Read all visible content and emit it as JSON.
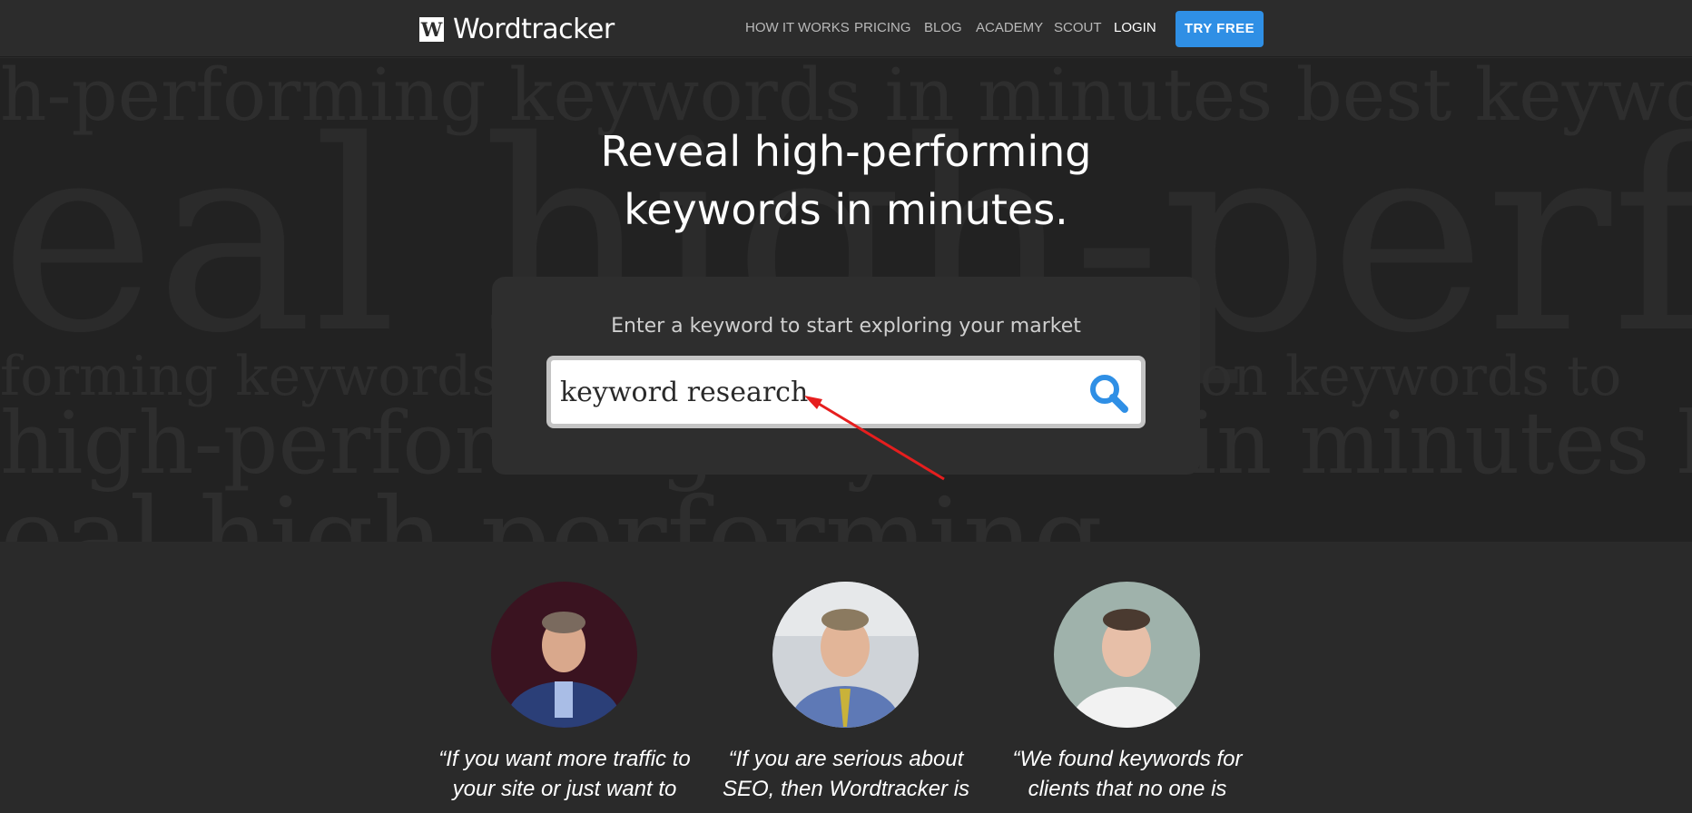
{
  "brand": {
    "mark": "W",
    "name": "Wordtracker"
  },
  "nav": {
    "items": [
      "HOW IT WORKS",
      "PRICING",
      "BLOG",
      "ACADEMY",
      "SCOUT",
      "LOGIN"
    ],
    "cta": "TRY FREE"
  },
  "hero": {
    "background_lines": [
      "h-performing keywords in minutes best keywords",
      "eal high-perform",
      "forming keywords in minutes low competition keywords to",
      "high-performing keywords in minutes be",
      "eal high-performing"
    ],
    "title_line1": "Reveal high-performing",
    "title_line2": "keywords in minutes.",
    "search_prompt": "Enter a keyword to start exploring your market",
    "search_value": "keyword research"
  },
  "testimonials": [
    {
      "quote_line1": "“If you want more traffic to",
      "quote_line2": "your site or just want to"
    },
    {
      "quote_line1": "“If you are serious about",
      "quote_line2": "SEO, then Wordtracker is"
    },
    {
      "quote_line1": "“We found keywords for",
      "quote_line2": "clients that no one is"
    }
  ],
  "colors": {
    "accent": "#2f8fe5",
    "arrow": "#e61e1e",
    "search_icon": "#2f8fe5"
  }
}
